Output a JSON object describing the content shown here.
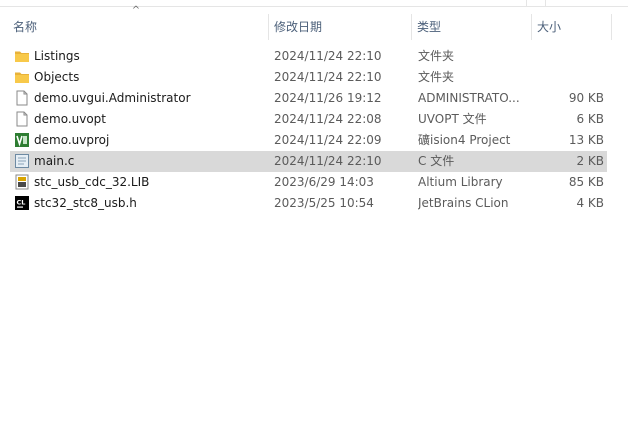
{
  "columns": {
    "name": "名称",
    "date": "修改日期",
    "type": "类型",
    "size": "大小"
  },
  "sort_indicator": "^",
  "files": [
    {
      "name": "Listings",
      "date": "2024/11/24 22:10",
      "type": "文件夹",
      "size": "",
      "icon": "folder-icon"
    },
    {
      "name": "Objects",
      "date": "2024/11/24 22:10",
      "type": "文件夹",
      "size": "",
      "icon": "folder-icon"
    },
    {
      "name": "demo.uvgui.Administrator",
      "date": "2024/11/26 19:12",
      "type": "ADMINISTRATO...",
      "size": "90 KB",
      "icon": "blank-file-icon"
    },
    {
      "name": "demo.uvopt",
      "date": "2024/11/24 22:08",
      "type": "UVOPT 文件",
      "size": "6 KB",
      "icon": "blank-file-icon"
    },
    {
      "name": "demo.uvproj",
      "date": "2024/11/24 22:09",
      "type": "礦ision4 Project",
      "size": "13 KB",
      "icon": "uvision-project-icon"
    },
    {
      "name": "main.c",
      "date": "2024/11/24 22:10",
      "type": "C 文件",
      "size": "2 KB",
      "icon": "c-source-file-icon",
      "selected": true
    },
    {
      "name": "stc_usb_cdc_32.LIB",
      "date": "2023/6/29 14:03",
      "type": "Altium Library",
      "size": "85 KB",
      "icon": "library-file-icon"
    },
    {
      "name": "stc32_stc8_usb.h",
      "date": "2023/5/25 10:54",
      "type": "JetBrains CLion",
      "size": "4 KB",
      "icon": "clion-file-icon"
    }
  ],
  "colors": {
    "selected_row": "#d9d9d9",
    "header_text": "#4c607a",
    "folder": "#f8c94a"
  }
}
